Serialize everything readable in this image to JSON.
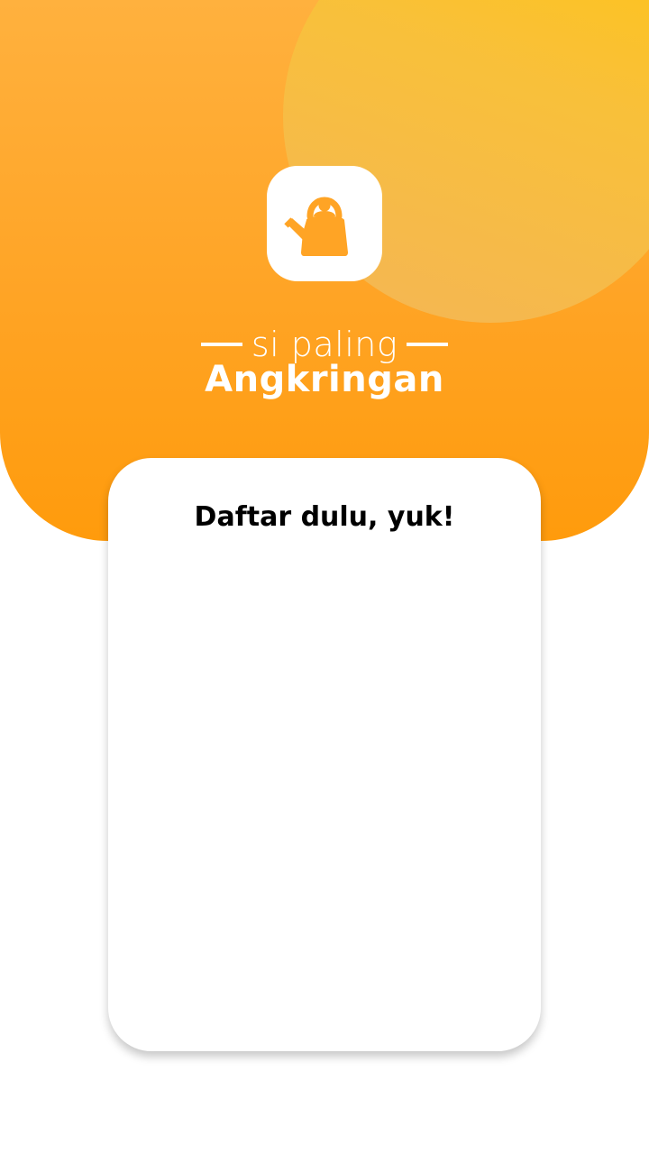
{
  "app": {
    "tagline": "si paling",
    "name": "Angkringan",
    "logo_icon": "kettle-icon"
  },
  "signup_card": {
    "title": "Daftar dulu, yuk!"
  },
  "colors": {
    "primary": "#ffa425",
    "accent": "#ffc50f",
    "card_background": "#ffffff",
    "text_on_primary": "#ffffff"
  }
}
